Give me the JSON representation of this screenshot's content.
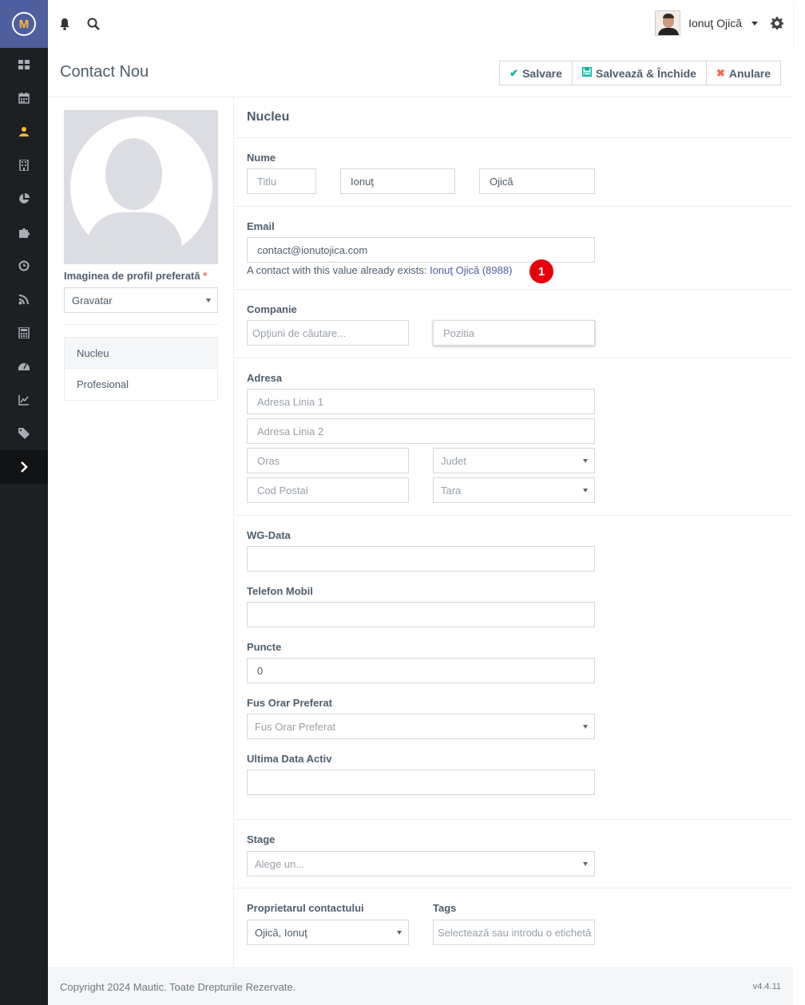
{
  "app": {
    "logo_letter": "M"
  },
  "sidebar": {
    "items": [
      {
        "icon": "dashboard-icon"
      },
      {
        "icon": "calendar-icon"
      },
      {
        "icon": "user-icon"
      },
      {
        "icon": "building-icon"
      },
      {
        "icon": "pie-chart-icon"
      },
      {
        "icon": "puzzle-icon"
      },
      {
        "icon": "clock-icon"
      },
      {
        "icon": "rss-icon"
      },
      {
        "icon": "calculator-icon"
      },
      {
        "icon": "gauge-icon"
      },
      {
        "icon": "line-chart-icon"
      },
      {
        "icon": "tag-icon"
      },
      {
        "icon": "chevron-right-icon"
      }
    ]
  },
  "topbar": {
    "user_name": "Ionuţ Ojică"
  },
  "header": {
    "title": "Contact Nou",
    "save": "Salvare",
    "save_close": "Salvează & Închide",
    "cancel": "Anulare"
  },
  "profile": {
    "pref_label": "Imaginea de profil preferată",
    "required_mark": "*",
    "pref_value": "Gravatar",
    "tabs": [
      "Nucleu",
      "Profesional"
    ]
  },
  "form": {
    "section_title": "Nucleu",
    "name_label": "Nume",
    "title_placeholder": "Titlu",
    "first_name": "Ionuţ",
    "last_name": "Ojică",
    "email_label": "Email",
    "email_value": "contact@ionutojica.com",
    "email_hint": "A contact with this value already exists:",
    "email_hint_link": "Ionuţ Ojică (8988)",
    "badge": "1",
    "company_label": "Companie",
    "company_placeholder": "Opţiuni de căutare...",
    "position_placeholder": "Pozitia",
    "address_label": "Adresa",
    "address1_placeholder": "Adresa Linia 1",
    "address2_placeholder": "Adresa Linia 2",
    "city_placeholder": "Oras",
    "county_placeholder": "Judet",
    "zip_placeholder": "Cod Postal",
    "country_placeholder": "Tara",
    "wg_label": "WG-Data",
    "wg_value": "",
    "mobile_label": "Telefon Mobil",
    "mobile_value": "",
    "points_label": "Puncte",
    "points_value": "0",
    "timezone_label": "Fus Orar Preferat",
    "timezone_placeholder": "Fus Orar Preferat",
    "last_active_label": "Ultima Data Activ",
    "last_active_value": "",
    "stage_label": "Stage",
    "stage_placeholder": "Alege un...",
    "owner_label": "Proprietarul contactului",
    "owner_value": "Ojică, Ionuţ",
    "tags_label": "Tags",
    "tags_placeholder": "Selectează sau introdu o etichetă"
  },
  "footer": {
    "copyright": "Copyright 2024 Mautic. Toate Drepturile Rezervate.",
    "version": "v4.4.11"
  }
}
